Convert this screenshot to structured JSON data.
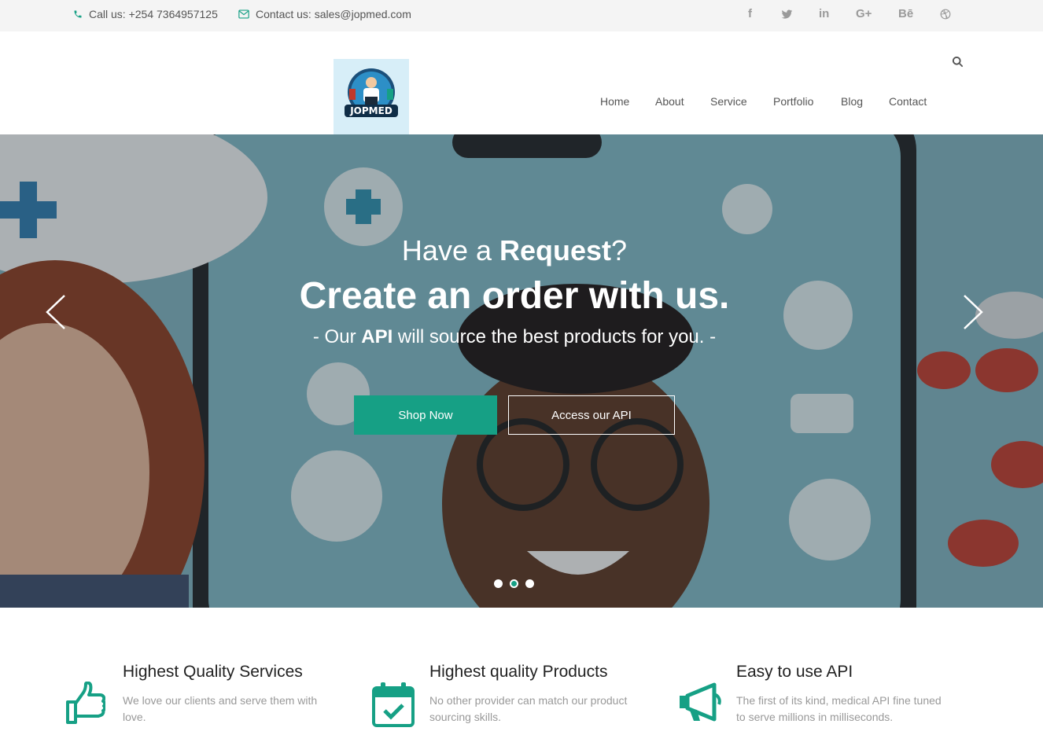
{
  "topbar": {
    "phone": "Call us: +254 7364957125",
    "email": "Contact us: sales@jopmed.com",
    "social": [
      "f",
      "t",
      "in",
      "G+",
      "Bē",
      "dribbble"
    ]
  },
  "header": {
    "logo_text": "JOPMED",
    "nav": [
      "Home",
      "About",
      "Service",
      "Portfolio",
      "Blog",
      "Contact"
    ]
  },
  "hero": {
    "line1_pre": "Have a ",
    "line1_bold": "Request",
    "line1_post": "?",
    "line2": "Create an order with us.",
    "line3_pre": "- Our ",
    "line3_bold": "API",
    "line3_post": " will source the best products for you. -",
    "btn_shop": "Shop Now",
    "btn_api": "Access our API",
    "slides": 3,
    "active_slide": 2
  },
  "features": [
    {
      "title": "Highest Quality Services",
      "desc": "We love our clients and serve them with love.",
      "icon": "thumbs-up-icon"
    },
    {
      "title": "Highest quality Products",
      "desc": "No other provider can match our product sourcing skills.",
      "icon": "calendar-check-icon"
    },
    {
      "title": "Easy to use API",
      "desc": "The first of its kind, medical API fine tuned to serve millions in milliseconds.",
      "icon": "megaphone-icon"
    }
  ],
  "colors": {
    "accent": "#16a085",
    "topbar": "#f4f4f4"
  }
}
